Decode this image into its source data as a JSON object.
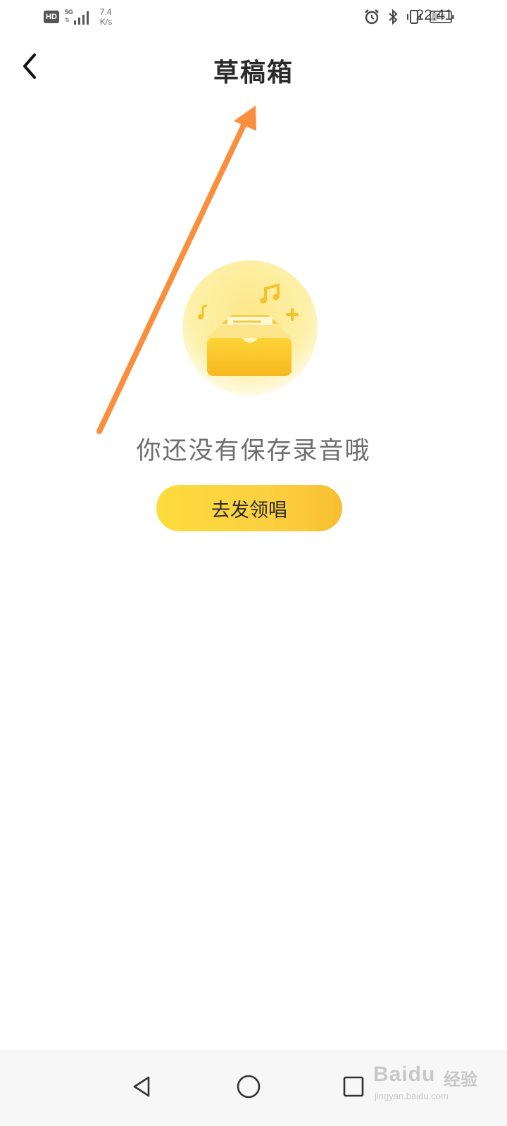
{
  "status_bar": {
    "hd_label": "HD",
    "network_type": "5G",
    "speed_value": "7.4",
    "speed_unit": "K/s",
    "battery_level": "26",
    "time": "22:41",
    "icons": [
      "alarm-icon",
      "bluetooth-icon",
      "vibrate-icon"
    ]
  },
  "header": {
    "title": "草稿箱",
    "back_icon": "chevron-left-icon"
  },
  "empty_state": {
    "illustration": "inbox-tray-with-music-notes-icon",
    "message": "你还没有保存录音哦",
    "button_label": "去发领唱"
  },
  "nav_bar": {
    "icons": [
      "nav-back-icon",
      "nav-home-icon",
      "nav-recents-icon"
    ]
  },
  "watermark": {
    "brand": "Baidu",
    "brand_cn": "经验",
    "url": "jingyan.baidu.com"
  },
  "colors": {
    "accent_yellow": "#fcd040",
    "annotation_orange": "#f98f3c",
    "text_gray": "#6e6e6e"
  }
}
